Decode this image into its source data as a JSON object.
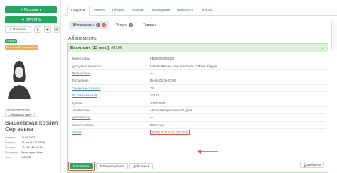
{
  "sidebar": {
    "sell_label": "Продать",
    "checkin_label": "Впустить",
    "edit_label": "Изменить",
    "badges": [
      {
        "text": "Открыт",
        "color": "#27a660"
      },
      {
        "text": "Есть COVID-сертификат",
        "color": "#f0ad4e"
      }
    ],
    "card_number": "FB000000000230",
    "print_card_label": "Привязать карту",
    "client_name": "Вишневская Ксения Сергеевна",
    "info": [
      {
        "key": "Клиент с",
        "value": "10.03.2023"
      },
      {
        "key": "Возраст",
        "value": "19 лет (18.11.2003)"
      },
      {
        "key": "Телефон",
        "value": "+7 961 111-26-10"
      },
      {
        "key": "Менеджер",
        "value": "Кузменцерт Иван"
      },
      {
        "key": "Счёт",
        "value": "1 000 ₽"
      }
    ]
  },
  "tabs": [
    "Покупки",
    "Записи",
    "Общее",
    "Заявки",
    "Посещения",
    "Финансы",
    "Отзывы"
  ],
  "active_tab": "Покупки",
  "subtabs": [
    {
      "label": "Абонементы",
      "count": "1",
      "count2": "0"
    },
    {
      "label": "Услуги",
      "count": "1"
    },
    {
      "label": "Товары"
    }
  ],
  "section_title": "Абонементы",
  "subscription": {
    "name": "Безлимит [12 мес.]",
    "id": "#8196",
    "rows": [
      {
        "key": "Номер карты",
        "value": "FB000000000230",
        "link": false
      },
      {
        "key": "Доступные филиалы",
        "value": "FitBase Фитнес-клуб (пробное), FitBase Студия",
        "link": false
      },
      {
        "key": "Пролонгация",
        "value": "—",
        "link": true
      },
      {
        "key": "Расписание",
        "value": "Пн-Вс 06:00-23:00",
        "link": false
      },
      {
        "key": "Заморозок осталось",
        "value": "28",
        "link": true
      },
      {
        "key": "Гостевых визитов",
        "value": "10 / 10",
        "link": true
      },
      {
        "key": "Куплен",
        "value": "20.03.2023",
        "link": false
      },
      {
        "key": "Активирован",
        "value": "Автоактивация через 30 дней",
        "link": false
      },
      {
        "key": "Действует до",
        "value": "—",
        "link": true
      },
      {
        "key": "Способ оплаты",
        "value": "Наличные",
        "link": false
      },
      {
        "key": "Сумма",
        "value": "5 000.00 ₽ из 21 200.00 ₽",
        "link": true,
        "highlight": true
      }
    ]
  },
  "actions": {
    "pay_label": "Оплатить",
    "edit_label": "Редактировать",
    "more_label": "Действия",
    "templates_label": "Шаблоны"
  },
  "colors": {
    "accent_green": "#27a660",
    "highlight_red": "#d9534f",
    "link_blue": "#4a7fb5"
  }
}
